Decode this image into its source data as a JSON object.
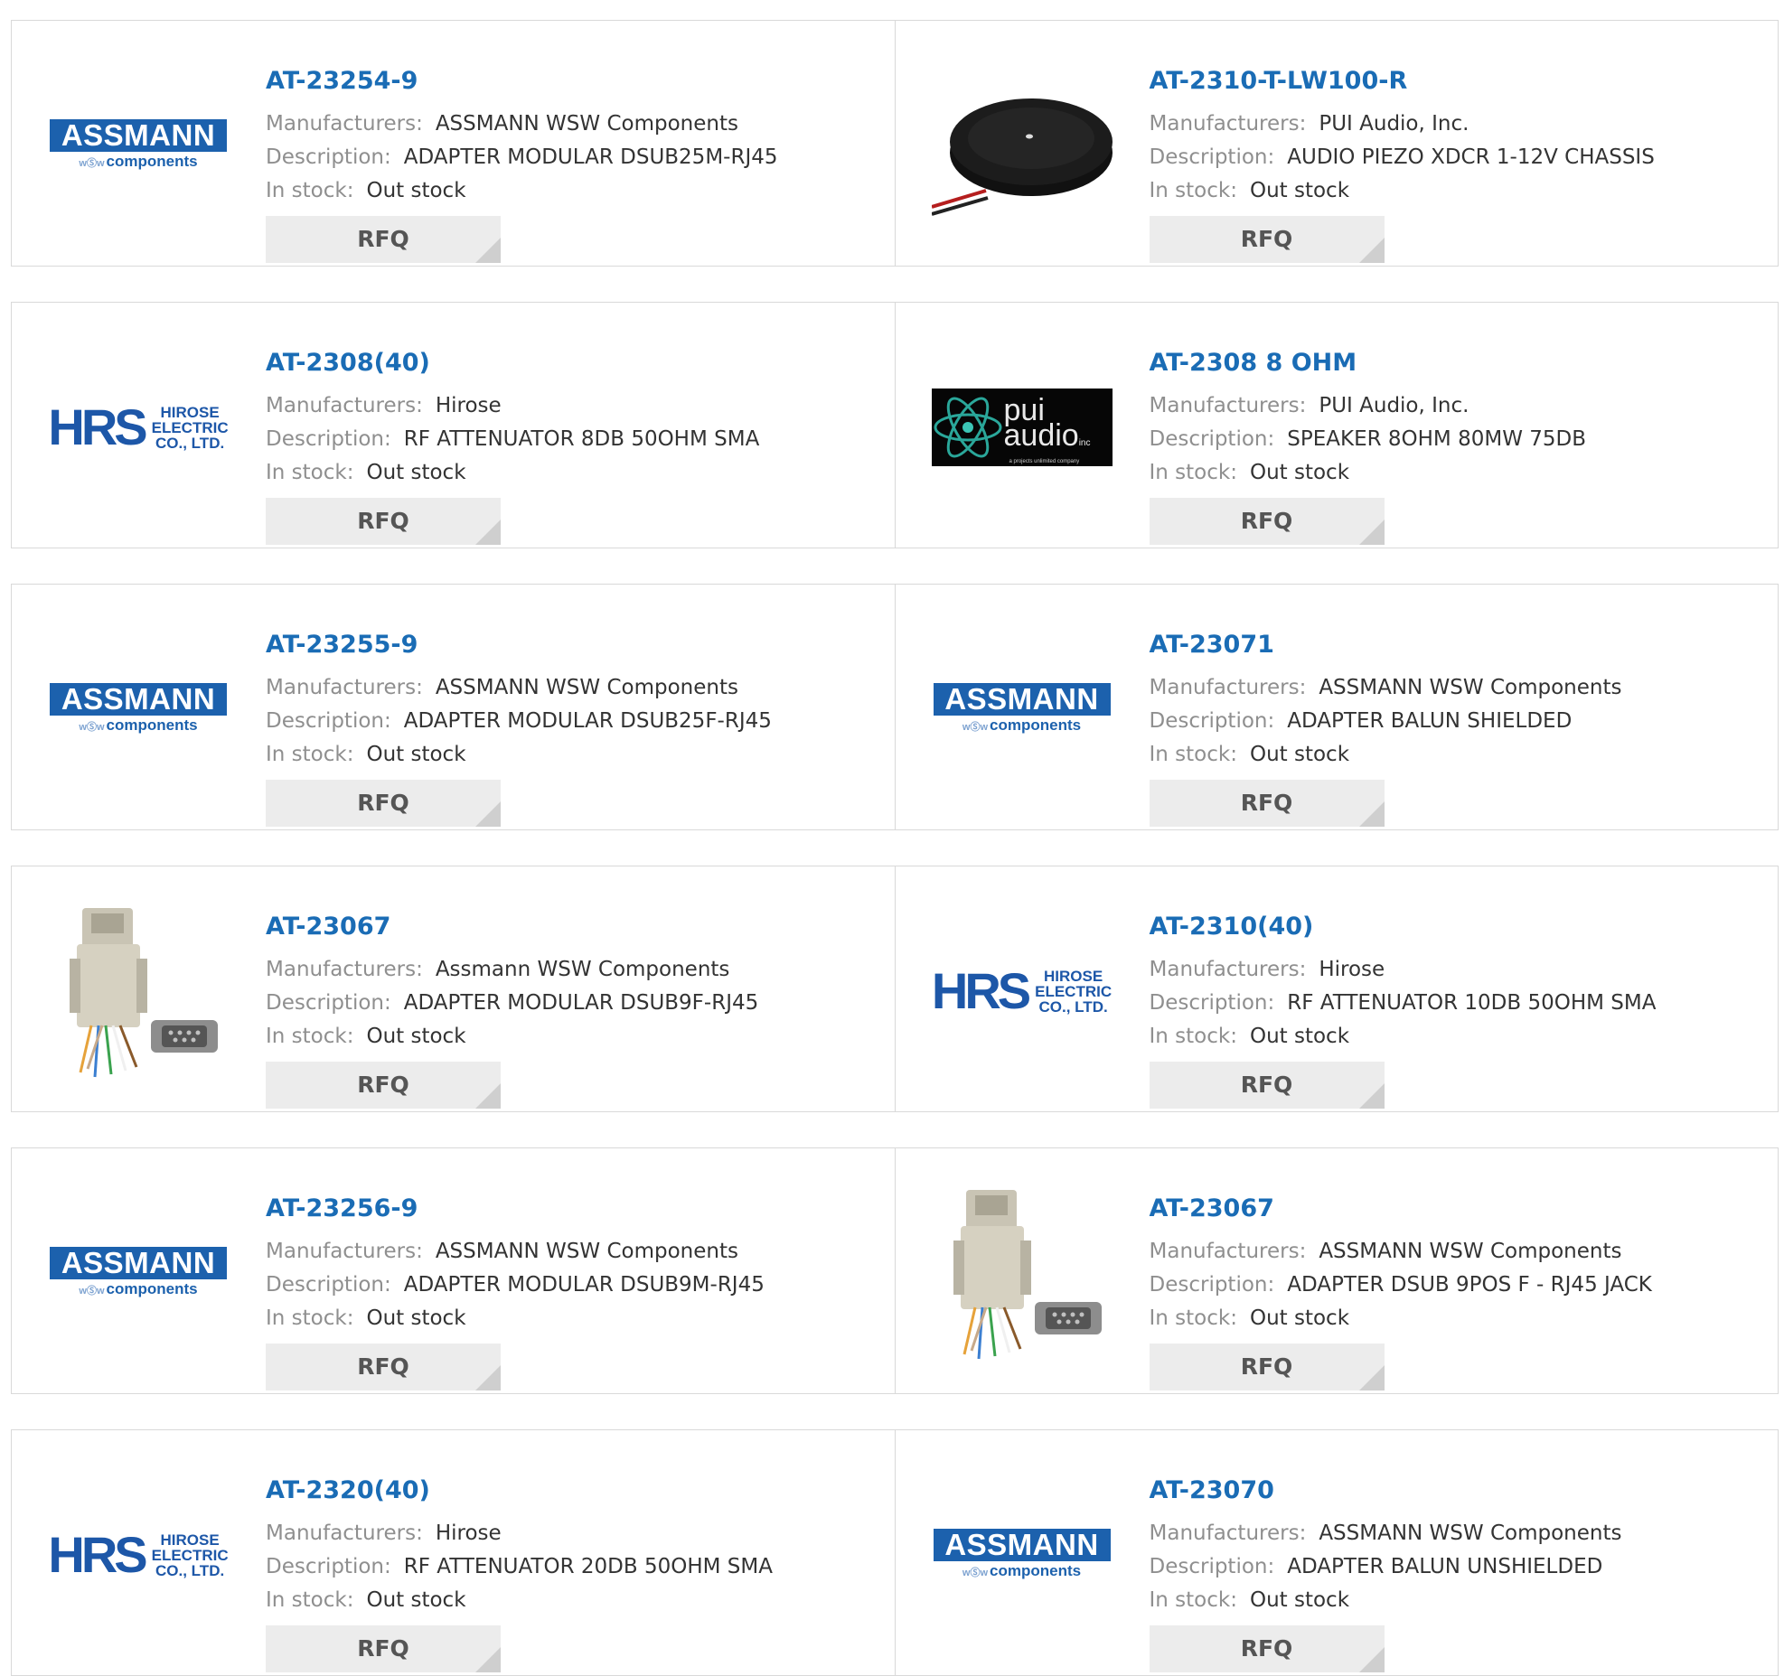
{
  "labels": {
    "manufacturers": "Manufacturers:",
    "description": "Description:",
    "stock": "In stock:",
    "rfq": "RFQ"
  },
  "logos": {
    "assmann_top": "ASSMANN",
    "assmann_sub": "components",
    "assmann_wsw": "wⓈw",
    "hrs_mark": "HRS",
    "hrs_line1": "HIROSE",
    "hrs_line2": "ELECTRIC",
    "hrs_line3": "CO., LTD.",
    "pui_line1": "pui",
    "pui_line2": "audio",
    "pui_suffix": "inc",
    "pui_tagline": "a projects unlimited company"
  },
  "colors": {
    "part_link": "#1a6cb5",
    "label": "#8f8f8f",
    "value": "#333333",
    "border": "#d9d9d9",
    "rfq_bg": "#ececec",
    "assmann_blue": "#1c61ad",
    "hrs_blue": "#1d57a8"
  },
  "products": [
    {
      "part": "AT-23254-9",
      "manufacturer": "ASSMANN WSW Components",
      "description": "ADAPTER MODULAR DSUB25M-RJ45",
      "stock": "Out stock",
      "image": "assmann-logo"
    },
    {
      "part": "AT-2310-T-LW100-R",
      "manufacturer": "PUI Audio, Inc.",
      "description": "AUDIO PIEZO XDCR 1-12V CHASSIS",
      "stock": "Out stock",
      "image": "piezo-disc-photo"
    },
    {
      "part": "AT-2308(40)",
      "manufacturer": "Hirose",
      "description": "RF ATTENUATOR 8DB 50OHM SMA",
      "stock": "Out stock",
      "image": "hrs-logo"
    },
    {
      "part": "AT-2308 8 OHM",
      "manufacturer": "PUI Audio, Inc.",
      "description": "SPEAKER 8OHM 80MW 75DB",
      "stock": "Out stock",
      "image": "pui-audio-logo"
    },
    {
      "part": "AT-23255-9",
      "manufacturer": "ASSMANN WSW Components",
      "description": "ADAPTER MODULAR DSUB25F-RJ45",
      "stock": "Out stock",
      "image": "assmann-logo"
    },
    {
      "part": "AT-23071",
      "manufacturer": "ASSMANN WSW Components",
      "description": "ADAPTER BALUN SHIELDED",
      "stock": "Out stock",
      "image": "assmann-logo"
    },
    {
      "part": "AT-23067",
      "manufacturer": "Assmann WSW Components",
      "description": "ADAPTER MODULAR DSUB9F-RJ45",
      "stock": "Out stock",
      "image": "dsub-adapter-photo"
    },
    {
      "part": "AT-2310(40)",
      "manufacturer": "Hirose",
      "description": "RF ATTENUATOR 10DB 50OHM SMA",
      "stock": "Out stock",
      "image": "hrs-logo"
    },
    {
      "part": "AT-23256-9",
      "manufacturer": "ASSMANN WSW Components",
      "description": "ADAPTER MODULAR DSUB9M-RJ45",
      "stock": "Out stock",
      "image": "assmann-logo"
    },
    {
      "part": "AT-23067",
      "manufacturer": "ASSMANN WSW Components",
      "description": "ADAPTER DSUB 9POS F - RJ45 JACK",
      "stock": "Out stock",
      "image": "dsub-adapter-photo"
    },
    {
      "part": "AT-2320(40)",
      "manufacturer": "Hirose",
      "description": "RF ATTENUATOR 20DB 50OHM SMA",
      "stock": "Out stock",
      "image": "hrs-logo"
    },
    {
      "part": "AT-23070",
      "manufacturer": "ASSMANN WSW Components",
      "description": "ADAPTER BALUN UNSHIELDED",
      "stock": "Out stock",
      "image": "assmann-logo"
    }
  ]
}
